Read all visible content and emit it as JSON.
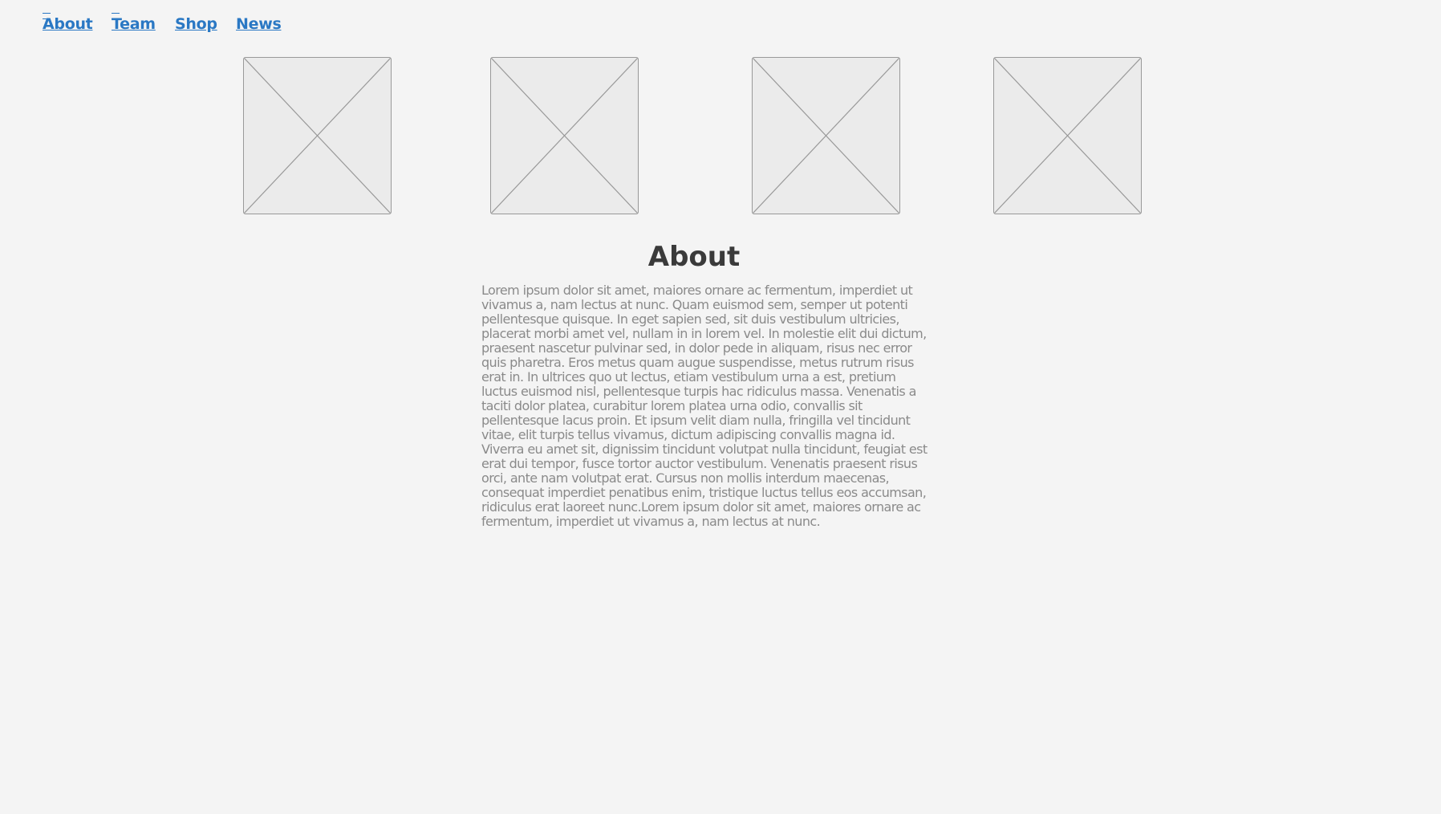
{
  "nav": {
    "links": [
      {
        "label": "About"
      },
      {
        "label": "Team"
      },
      {
        "label": "Shop"
      },
      {
        "label": "News"
      }
    ]
  },
  "gallery": {
    "count": 4
  },
  "about": {
    "title": "About",
    "body": "Lorem ipsum dolor sit amet, maiores ornare ac fermentum, imperdiet ut vivamus a, nam lectus at nunc. Quam euismod sem, semper ut potenti pellentesque quisque. In eget sapien sed, sit duis vestibulum ultricies, placerat morbi amet vel, nullam in in lorem vel. In molestie elit dui dictum, praesent nascetur pulvinar sed, in dolor pede in aliquam, risus nec error quis pharetra. Eros metus quam augue suspendisse, metus rutrum risus erat in.  In ultrices quo ut lectus, etiam vestibulum urna a est, pretium luctus euismod nisl, pellentesque turpis hac ridiculus massa. Venenatis a taciti dolor platea, curabitur lorem platea urna odio, convallis sit pellentesque lacus proin. Et ipsum velit diam nulla, fringilla vel tincidunt vitae, elit turpis tellus vivamus, dictum adipiscing convallis magna id. Viverra eu amet sit, dignissim tincidunt volutpat nulla tincidunt, feugiat est erat dui tempor, fusce tortor auctor vestibulum. Venenatis praesent risus orci, ante nam volutpat erat. Cursus non mollis interdum maecenas, consequat imperdiet penatibus enim, tristique luctus tellus eos accumsan, ridiculus erat laoreet nunc.Lorem ipsum dolor sit amet, maiores ornare ac fermentum, imperdiet ut vivamus a, nam lectus at nunc."
  }
}
